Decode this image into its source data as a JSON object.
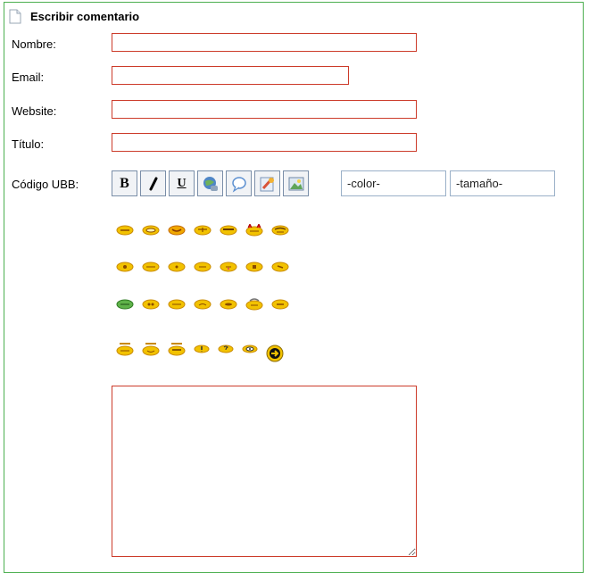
{
  "section": {
    "title": "Escribir comentario",
    "icon": "document-icon"
  },
  "form": {
    "nombre_label": "Nombre:",
    "email_label": "Email:",
    "website_label": "Website:",
    "titulo_label": "Título:",
    "ubb_label": "Código UBB:",
    "nombre_value": "",
    "email_value": "",
    "website_value": "",
    "titulo_value": "",
    "comment_value": ""
  },
  "toolbar": {
    "buttons": [
      "bold-icon",
      "italic-icon",
      "underline-icon",
      "url-icon",
      "quote-icon",
      "code-icon",
      "image-icon"
    ],
    "bold_glyph": "B",
    "underline_glyph": "U",
    "color_select": "-color-",
    "size_select": "-tamaño-"
  },
  "smileys": {
    "rows": [
      [
        "smiley-grin",
        "smiley-smile",
        "smiley-happy",
        "smiley-wink",
        "smiley-laugh",
        "smiley-devil",
        "smiley-cool"
      ],
      [
        "smiley-neutral",
        "smiley-sad",
        "smiley-confused",
        "smiley-blush",
        "smiley-tongue",
        "smiley-surprised",
        "smiley-kiss"
      ],
      [
        "smiley-sick",
        "smiley-roll",
        "smiley-sleep",
        "smiley-mad",
        "smiley-cry",
        "smiley-shock",
        "smiley-frown"
      ],
      [
        "smiley-hat",
        "smiley-hat2",
        "smiley-hat3",
        "smiley-exclaim",
        "smiley-question",
        "smiley-eyes",
        "smiley-arrow"
      ]
    ]
  },
  "colors": {
    "field_border": "#cc3b2a",
    "panel_border": "#4caf50",
    "smiley_yellow": "#f2c200"
  }
}
